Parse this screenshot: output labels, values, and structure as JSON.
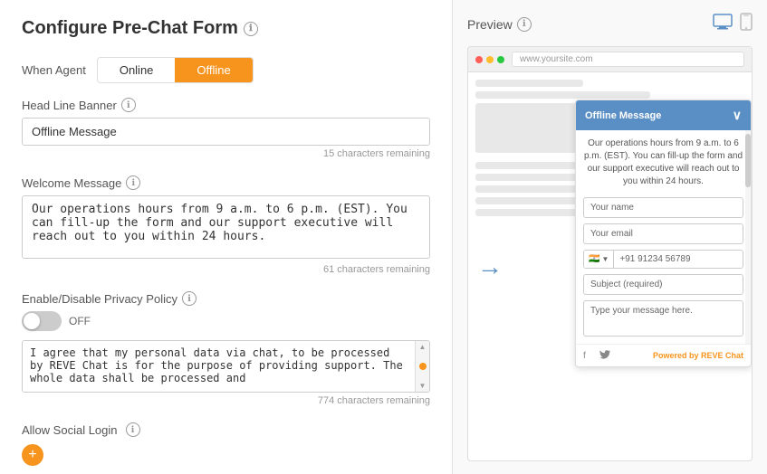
{
  "page": {
    "title": "Configure Pre-Chat Form",
    "info_icon": "ℹ"
  },
  "agent_toggle": {
    "label": "When Agent",
    "online_label": "Online",
    "offline_label": "Offline",
    "active": "offline"
  },
  "headline_banner": {
    "label": "Head Line Banner",
    "value": "Offline Message",
    "char_remaining": "15 characters remaining"
  },
  "welcome_message": {
    "label": "Welcome Message",
    "value": "Our operations hours from 9 a.m. to 6 p.m. (EST). You can fill-up the form and our support executive will reach out to you within 24 hours.",
    "char_remaining": "61 characters remaining"
  },
  "privacy_policy": {
    "label": "Enable/Disable Privacy Policy",
    "toggle_label": "OFF",
    "textarea_value": "I agree that my personal data via chat, to be processed by REVE Chat is for the purpose of providing support. The whole data shall be processed and",
    "char_remaining": "774 characters remaining"
  },
  "social_login": {
    "label": "Allow Social Login"
  },
  "preview": {
    "title": "Preview",
    "url": "www.yoursite.com"
  },
  "chat_widget": {
    "header": "Offline Message",
    "close_icon": "∨",
    "welcome_text": "Our operations hours from 9 a.m. to 6 p.m. (EST). You can fill-up the form and our support executive will reach out to you within 24 hours.",
    "name_placeholder": "Your name",
    "email_placeholder": "Your email",
    "phone_flag": "🇮🇳",
    "phone_dropdown": "▼",
    "phone_value": "+91 91234 56789",
    "subject_placeholder": "Subject (required)",
    "message_placeholder": "Type your message here.",
    "powered_by": "Powered by",
    "brand": "REVE Chat"
  }
}
